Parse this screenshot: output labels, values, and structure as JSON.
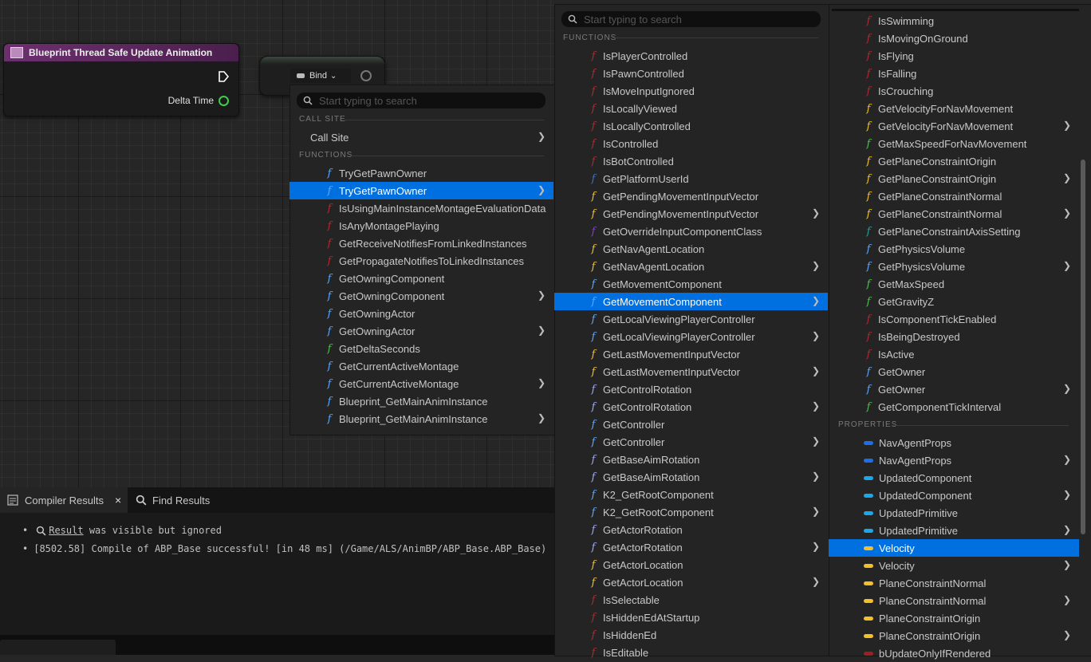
{
  "colors": {
    "selected": "#0070e0",
    "pure_func": "#5aa8ff",
    "event_func": "#9e1f22",
    "green_func": "#4ec04a",
    "yellow": "#f3c029",
    "purple": "#7d3fd6",
    "teal": "#25a091",
    "prop_blue": "#1e6ee8",
    "prop_cyan": "#1aa7ec",
    "prop_yellow": "#f3c029"
  },
  "node_event": {
    "title": "Blueprint Thread Safe Update Animation",
    "delta_label": "Delta Time"
  },
  "bind": {
    "label": "Bind"
  },
  "menu1": {
    "search_placeholder": "Start typing to search",
    "callsite_header": "CALL SITE",
    "callsite_item": "Call Site",
    "functions_header": "FUNCTIONS",
    "items": [
      {
        "label": "TryGetPawnOwner",
        "icon": "f",
        "color": "#5aa8ff",
        "arrow": false
      },
      {
        "label": "TryGetPawnOwner",
        "icon": "f",
        "color": "#5aa8ff",
        "arrow": true,
        "selected": true
      },
      {
        "label": "IsUsingMainInstanceMontageEvaluationData",
        "icon": "f",
        "color": "#b02a2d",
        "arrow": false
      },
      {
        "label": "IsAnyMontagePlaying",
        "icon": "f",
        "color": "#b02a2d",
        "arrow": false
      },
      {
        "label": "GetReceiveNotifiesFromLinkedInstances",
        "icon": "f",
        "color": "#b02a2d",
        "arrow": false
      },
      {
        "label": "GetPropagateNotifiesToLinkedInstances",
        "icon": "f",
        "color": "#b02a2d",
        "arrow": false
      },
      {
        "label": "GetOwningComponent",
        "icon": "f",
        "color": "#5aa8ff",
        "arrow": false
      },
      {
        "label": "GetOwningComponent",
        "icon": "f",
        "color": "#5aa8ff",
        "arrow": true
      },
      {
        "label": "GetOwningActor",
        "icon": "f",
        "color": "#5aa8ff",
        "arrow": false
      },
      {
        "label": "GetOwningActor",
        "icon": "f",
        "color": "#5aa8ff",
        "arrow": true
      },
      {
        "label": "GetDeltaSeconds",
        "icon": "f",
        "color": "#4ec04a",
        "arrow": false
      },
      {
        "label": "GetCurrentActiveMontage",
        "icon": "f",
        "color": "#5aa8ff",
        "arrow": false
      },
      {
        "label": "GetCurrentActiveMontage",
        "icon": "f",
        "color": "#5aa8ff",
        "arrow": true
      },
      {
        "label": "Blueprint_GetMainAnimInstance",
        "icon": "f",
        "color": "#5aa8ff",
        "arrow": false
      },
      {
        "label": "Blueprint_GetMainAnimInstance",
        "icon": "f",
        "color": "#5aa8ff",
        "arrow": true
      }
    ]
  },
  "menu2": {
    "search_placeholder": "Start typing to search",
    "functions_header": "FUNCTIONS",
    "items": [
      {
        "label": "IsPlayerControlled",
        "color": "#b02a2d",
        "arrow": false
      },
      {
        "label": "IsPawnControlled",
        "color": "#b02a2d",
        "arrow": false
      },
      {
        "label": "IsMoveInputIgnored",
        "color": "#b02a2d",
        "arrow": false
      },
      {
        "label": "IsLocallyViewed",
        "color": "#b02a2d",
        "arrow": false
      },
      {
        "label": "IsLocallyControlled",
        "color": "#b02a2d",
        "arrow": false
      },
      {
        "label": "IsControlled",
        "color": "#b02a2d",
        "arrow": false
      },
      {
        "label": "IsBotControlled",
        "color": "#b02a2d",
        "arrow": false
      },
      {
        "label": "GetPlatformUserId",
        "color": "#3a6fd8",
        "arrow": false
      },
      {
        "label": "GetPendingMovementInputVector",
        "color": "#f3c029",
        "arrow": false
      },
      {
        "label": "GetPendingMovementInputVector",
        "color": "#f3c029",
        "arrow": true
      },
      {
        "label": "GetOverrideInputComponentClass",
        "color": "#7d3fd6",
        "arrow": false
      },
      {
        "label": "GetNavAgentLocation",
        "color": "#f3c029",
        "arrow": false
      },
      {
        "label": "GetNavAgentLocation",
        "color": "#f3c029",
        "arrow": true
      },
      {
        "label": "GetMovementComponent",
        "color": "#5aa8ff",
        "arrow": false
      },
      {
        "label": "GetMovementComponent",
        "color": "#5aa8ff",
        "arrow": true,
        "selected": true
      },
      {
        "label": "GetLocalViewingPlayerController",
        "color": "#5aa8ff",
        "arrow": false
      },
      {
        "label": "GetLocalViewingPlayerController",
        "color": "#5aa8ff",
        "arrow": true
      },
      {
        "label": "GetLastMovementInputVector",
        "color": "#f3c029",
        "arrow": false
      },
      {
        "label": "GetLastMovementInputVector",
        "color": "#f3c029",
        "arrow": true
      },
      {
        "label": "GetControlRotation",
        "color": "#9aa8ff",
        "arrow": false
      },
      {
        "label": "GetControlRotation",
        "color": "#9aa8ff",
        "arrow": true
      },
      {
        "label": "GetController",
        "color": "#5aa8ff",
        "arrow": false
      },
      {
        "label": "GetController",
        "color": "#5aa8ff",
        "arrow": true
      },
      {
        "label": "GetBaseAimRotation",
        "color": "#9aa8ff",
        "arrow": false
      },
      {
        "label": "GetBaseAimRotation",
        "color": "#9aa8ff",
        "arrow": true
      },
      {
        "label": "K2_GetRootComponent",
        "color": "#5aa8ff",
        "arrow": false
      },
      {
        "label": "K2_GetRootComponent",
        "color": "#5aa8ff",
        "arrow": true
      },
      {
        "label": "GetActorRotation",
        "color": "#9aa8ff",
        "arrow": false
      },
      {
        "label": "GetActorRotation",
        "color": "#9aa8ff",
        "arrow": true
      },
      {
        "label": "GetActorLocation",
        "color": "#f3c029",
        "arrow": false
      },
      {
        "label": "GetActorLocation",
        "color": "#f3c029",
        "arrow": true
      },
      {
        "label": "IsSelectable",
        "color": "#b02a2d",
        "arrow": false
      },
      {
        "label": "IsHiddenEdAtStartup",
        "color": "#b02a2d",
        "arrow": false
      },
      {
        "label": "IsHiddenEd",
        "color": "#b02a2d",
        "arrow": false
      },
      {
        "label": "IsEditable",
        "color": "#b02a2d",
        "arrow": false
      }
    ]
  },
  "menu3": {
    "properties_header": "PROPERTIES",
    "functions": [
      {
        "label": "IsSwimming",
        "color": "#b02a2d",
        "arrow": false
      },
      {
        "label": "IsMovingOnGround",
        "color": "#b02a2d",
        "arrow": false
      },
      {
        "label": "IsFlying",
        "color": "#b02a2d",
        "arrow": false
      },
      {
        "label": "IsFalling",
        "color": "#b02a2d",
        "arrow": false
      },
      {
        "label": "IsCrouching",
        "color": "#b02a2d",
        "arrow": false
      },
      {
        "label": "GetVelocityForNavMovement",
        "color": "#f3c029",
        "arrow": false
      },
      {
        "label": "GetVelocityForNavMovement",
        "color": "#f3c029",
        "arrow": true
      },
      {
        "label": "GetMaxSpeedForNavMovement",
        "color": "#4ec04a",
        "arrow": false
      },
      {
        "label": "GetPlaneConstraintOrigin",
        "color": "#f3c029",
        "arrow": false
      },
      {
        "label": "GetPlaneConstraintOrigin",
        "color": "#f3c029",
        "arrow": true
      },
      {
        "label": "GetPlaneConstraintNormal",
        "color": "#f3c029",
        "arrow": false
      },
      {
        "label": "GetPlaneConstraintNormal",
        "color": "#f3c029",
        "arrow": true
      },
      {
        "label": "GetPlaneConstraintAxisSetting",
        "color": "#25a091",
        "arrow": false
      },
      {
        "label": "GetPhysicsVolume",
        "color": "#5aa8ff",
        "arrow": false
      },
      {
        "label": "GetPhysicsVolume",
        "color": "#5aa8ff",
        "arrow": true
      },
      {
        "label": "GetMaxSpeed",
        "color": "#4ec04a",
        "arrow": false
      },
      {
        "label": "GetGravityZ",
        "color": "#4ec04a",
        "arrow": false
      },
      {
        "label": "IsComponentTickEnabled",
        "color": "#b02a2d",
        "arrow": false
      },
      {
        "label": "IsBeingDestroyed",
        "color": "#b02a2d",
        "arrow": false
      },
      {
        "label": "IsActive",
        "color": "#b02a2d",
        "arrow": false
      },
      {
        "label": "GetOwner",
        "color": "#5aa8ff",
        "arrow": false
      },
      {
        "label": "GetOwner",
        "color": "#5aa8ff",
        "arrow": true
      },
      {
        "label": "GetComponentTickInterval",
        "color": "#4ec04a",
        "arrow": false
      }
    ],
    "properties": [
      {
        "label": "NavAgentProps",
        "color": "#1e6ee8",
        "arrow": false
      },
      {
        "label": "NavAgentProps",
        "color": "#1e6ee8",
        "arrow": true
      },
      {
        "label": "UpdatedComponent",
        "color": "#1aa7ec",
        "arrow": false
      },
      {
        "label": "UpdatedComponent",
        "color": "#1aa7ec",
        "arrow": true
      },
      {
        "label": "UpdatedPrimitive",
        "color": "#1aa7ec",
        "arrow": false
      },
      {
        "label": "UpdatedPrimitive",
        "color": "#1aa7ec",
        "arrow": true
      },
      {
        "label": "Velocity",
        "color": "#f3c029",
        "arrow": false,
        "selected": true
      },
      {
        "label": "Velocity",
        "color": "#f3c029",
        "arrow": true
      },
      {
        "label": "PlaneConstraintNormal",
        "color": "#f3c029",
        "arrow": false
      },
      {
        "label": "PlaneConstraintNormal",
        "color": "#f3c029",
        "arrow": true
      },
      {
        "label": "PlaneConstraintOrigin",
        "color": "#f3c029",
        "arrow": false
      },
      {
        "label": "PlaneConstraintOrigin",
        "color": "#f3c029",
        "arrow": true
      },
      {
        "label": "bUpdateOnlyIfRendered",
        "color": "#9e1f22",
        "arrow": false
      }
    ]
  },
  "bottom_panel": {
    "tab_compiler": "Compiler Results",
    "tab_find": "Find Results",
    "log1_link": "Result",
    "log1_rest": " was visible but ignored",
    "log2": "[8502.58] Compile of ABP_Base successful! [in 48 ms] (/Game/ALS/AnimBP/ABP_Base.ABP_Base)"
  }
}
